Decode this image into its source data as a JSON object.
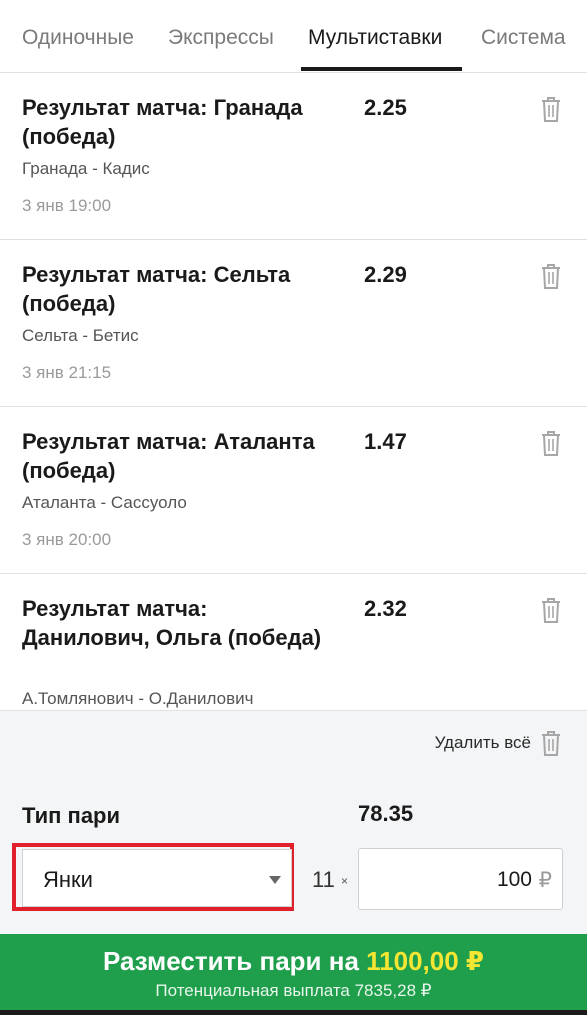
{
  "tabs": [
    {
      "label": "Одиночные",
      "active": false
    },
    {
      "label": "Экспрессы",
      "active": false
    },
    {
      "label": "Мультиставки",
      "active": true
    },
    {
      "label": "Система",
      "active": false
    }
  ],
  "bets": [
    {
      "title": "Результат матча: Гранада (победа)",
      "odds": "2.25",
      "match": "Гранада - Кадис",
      "time": "3 янв 19:00"
    },
    {
      "title": "Результат матча: Сельта (победа)",
      "odds": "2.29",
      "match": "Сельта - Бетис",
      "time": "3 янв 21:15"
    },
    {
      "title": "Результат матча: Аталанта (победа)",
      "odds": "1.47",
      "match": "Аталанта - Сассуоло",
      "time": "3 янв 20:00"
    },
    {
      "title": "Результат матча: Данилович, Ольга (победа)",
      "odds": "2.32",
      "match": "А.Томлянович - О.Данилович",
      "time": ""
    }
  ],
  "delete_all": {
    "label": "Удалить всё"
  },
  "bet_type": {
    "label": "Тип пари",
    "total_odds": "78.35",
    "selected": "Янки",
    "multiplier": "11",
    "multiplier_sign": "×",
    "stake": "100",
    "currency": "₽"
  },
  "place_bet": {
    "label": "Разместить пари на",
    "amount": "1100,00 ₽",
    "potential_payout": "Потенциальная выплата 7835,28 ₽"
  },
  "icons": {
    "delete": "trash-icon",
    "dropdown": "chevron-down-icon"
  },
  "colors": {
    "accent_green": "#1f9e4c",
    "amount_yellow": "#f5e634",
    "highlight_red": "#e0202a"
  }
}
